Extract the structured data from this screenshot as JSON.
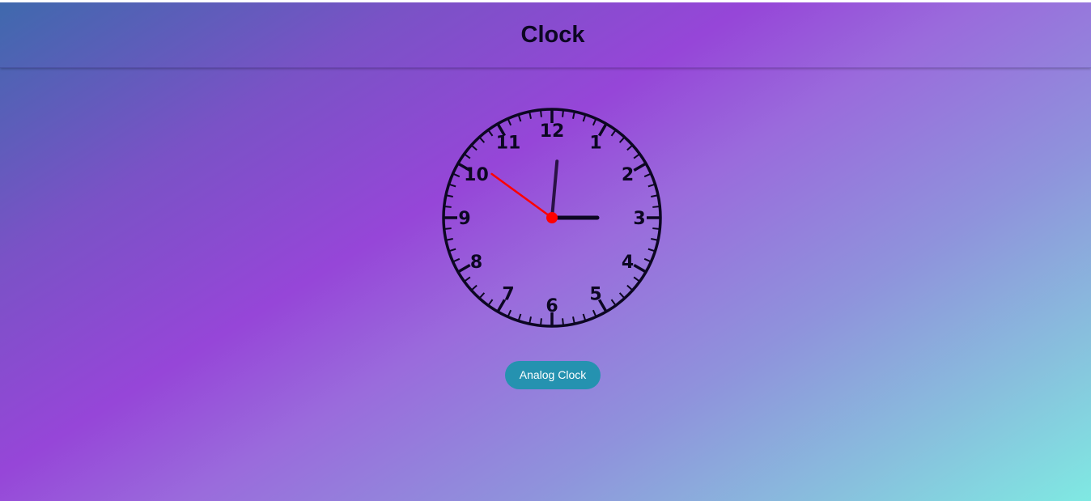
{
  "header": {
    "title": "Clock"
  },
  "clock": {
    "numerals": [
      "12",
      "1",
      "2",
      "3",
      "4",
      "5",
      "6",
      "7",
      "8",
      "9",
      "10",
      "11"
    ],
    "time": {
      "hour": 3,
      "minute": 0,
      "second": 51
    },
    "colors": {
      "face_stroke": "#0c0722",
      "hour_hand": "#0c0722",
      "minute_hand": "#2a1245",
      "second_hand": "#ff0000",
      "center_dot": "#ff0000"
    }
  },
  "controls": {
    "mode_button_label": "Analog Clock",
    "mode_button_color": "#2592b0"
  },
  "background": {
    "gradient_colors": [
      "#3f69ad",
      "#9646d8",
      "#8f93dc",
      "#7fe9e2"
    ]
  }
}
